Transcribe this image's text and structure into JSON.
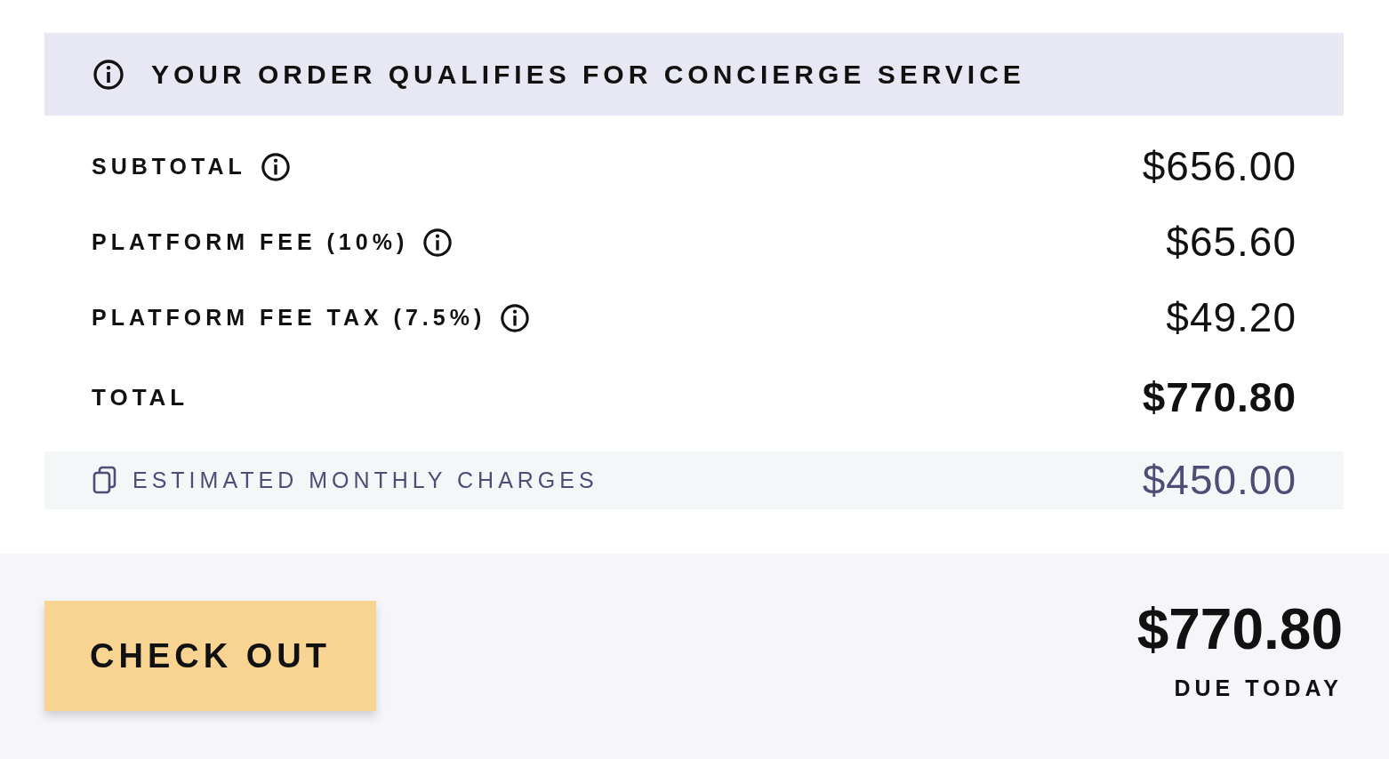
{
  "banner": {
    "text": "YOUR ORDER QUALIFIES FOR CONCIERGE SERVICE"
  },
  "lines": [
    {
      "kind": "normal",
      "label": "SUBTOTAL",
      "amount": "$656.00",
      "info": true
    },
    {
      "kind": "normal",
      "label": "PLATFORM FEE (10%)",
      "amount": "$65.60",
      "info": true
    },
    {
      "kind": "normal",
      "label": "PLATFORM FEE TAX (7.5%)",
      "amount": "$49.20",
      "info": true
    },
    {
      "kind": "total",
      "label": "TOTAL",
      "amount": "$770.80",
      "info": false
    },
    {
      "kind": "monthly",
      "label": "ESTIMATED MONTHLY CHARGES",
      "amount": "$450.00",
      "info": false
    }
  ],
  "footer": {
    "button": "CHECK OUT",
    "amount": "$770.80",
    "caption": "DUE TODAY"
  }
}
